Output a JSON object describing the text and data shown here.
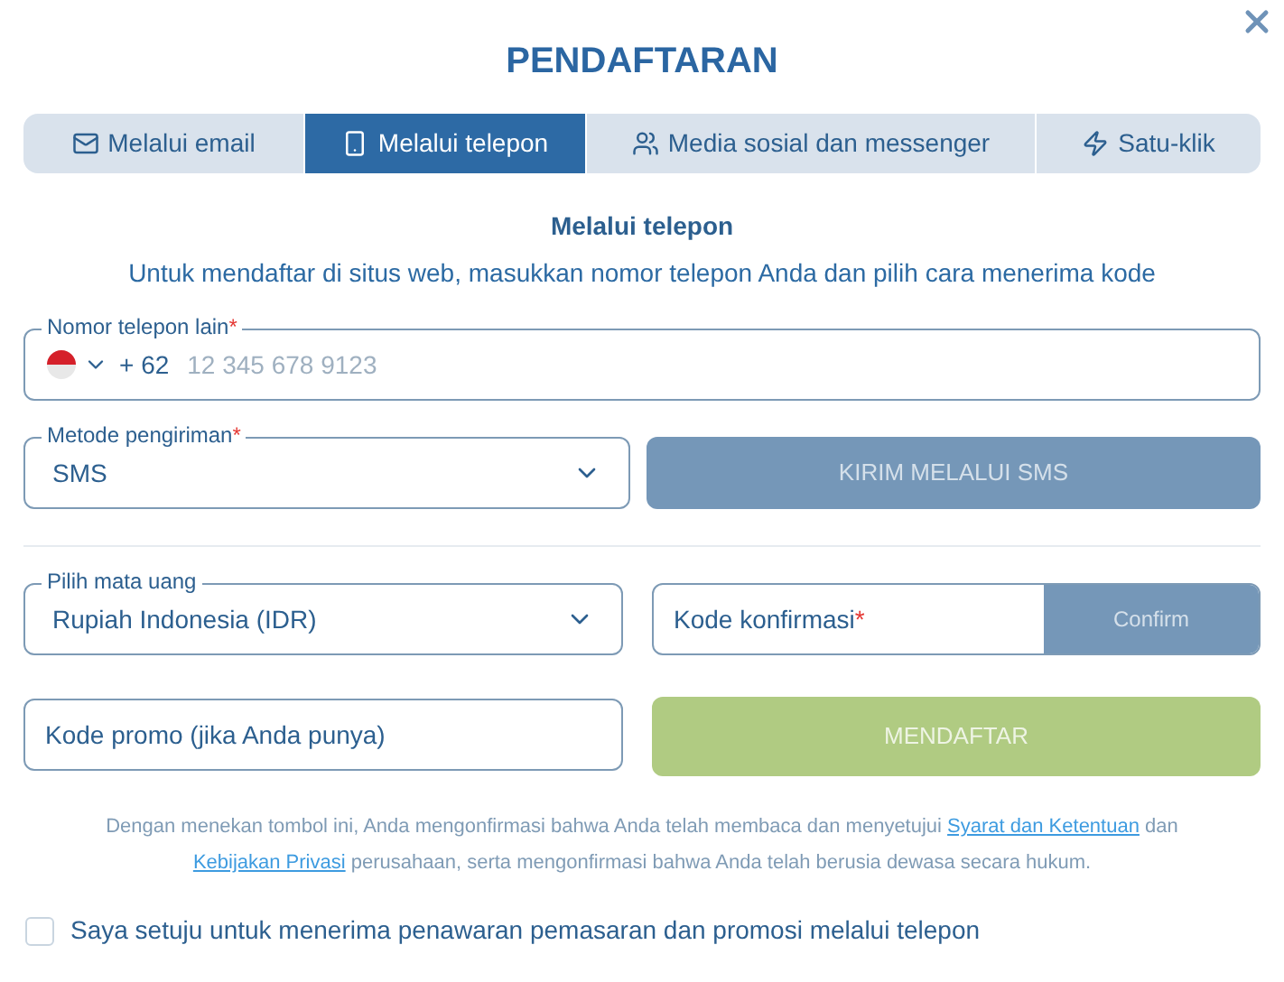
{
  "title": "PENDAFTARAN",
  "tabs": [
    {
      "label": "Melalui email",
      "selected": false
    },
    {
      "label": "Melalui telepon",
      "selected": true
    },
    {
      "label": "Media sosial dan messenger",
      "selected": false
    },
    {
      "label": "Satu-klik",
      "selected": false
    }
  ],
  "section": {
    "heading": "Melalui telepon",
    "subtitle": "Untuk mendaftar di situs web, masukkan nomor telepon Anda dan pilih cara menerima kode"
  },
  "phone": {
    "label": "Nomor telepon lain",
    "required_mark": "*",
    "code": "+ 62",
    "placeholder": "12 345 678 9123"
  },
  "method": {
    "label": "Metode pengiriman",
    "required_mark": "*",
    "value": "SMS"
  },
  "send_button": {
    "label": "KIRIM MELALUI SMS",
    "disabled": true
  },
  "currency": {
    "label": "Pilih mata uang",
    "value": "Rupiah Indonesia (IDR)"
  },
  "confirm_code": {
    "placeholder": "Kode konfirmasi",
    "required_mark": "*",
    "button": "Confirm",
    "disabled": true
  },
  "promo": {
    "placeholder": "Kode promo (jika Anda punya)"
  },
  "register_button": {
    "label": "MENDAFTAR",
    "disabled": true
  },
  "consent": {
    "parts": [
      {
        "kind": "text",
        "text": "Dengan menekan tombol ini, Anda mengonfirmasi bahwa Anda telah membaca dan menyetujui "
      },
      {
        "kind": "link",
        "text": "Syarat dan Ketentuan"
      },
      {
        "kind": "text",
        "text": " dan "
      },
      {
        "kind": "link",
        "text": "Kebijakan Privasi"
      },
      {
        "kind": "text",
        "text": " perusahaan, serta mengonfirmasi bahwa Anda telah berusia dewasa secara hukum."
      }
    ]
  },
  "marketing": {
    "label": "Saya setuju untuk menerima penawaran pemasaran dan promosi melalui telepon",
    "checked": false
  }
}
